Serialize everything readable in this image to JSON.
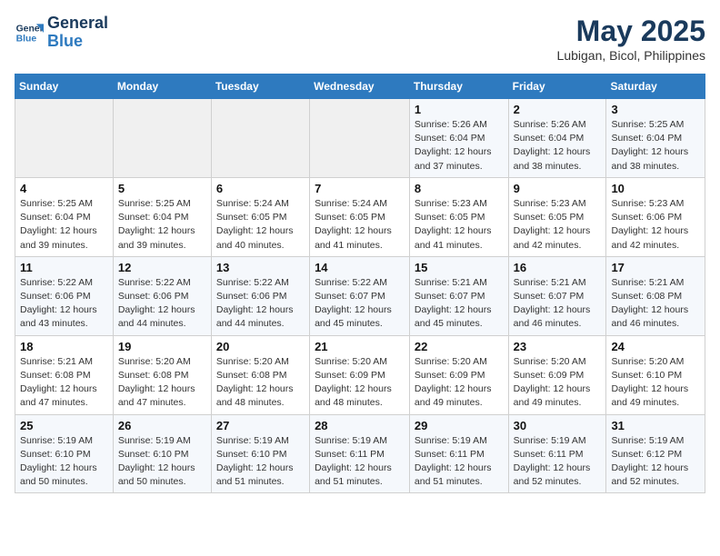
{
  "logo": {
    "line1": "General",
    "line2": "Blue"
  },
  "title": "May 2025",
  "subtitle": "Lubigan, Bicol, Philippines",
  "weekdays": [
    "Sunday",
    "Monday",
    "Tuesday",
    "Wednesday",
    "Thursday",
    "Friday",
    "Saturday"
  ],
  "weeks": [
    [
      {
        "day": "",
        "info": ""
      },
      {
        "day": "",
        "info": ""
      },
      {
        "day": "",
        "info": ""
      },
      {
        "day": "",
        "info": ""
      },
      {
        "day": "1",
        "info": "Sunrise: 5:26 AM\nSunset: 6:04 PM\nDaylight: 12 hours\nand 37 minutes."
      },
      {
        "day": "2",
        "info": "Sunrise: 5:26 AM\nSunset: 6:04 PM\nDaylight: 12 hours\nand 38 minutes."
      },
      {
        "day": "3",
        "info": "Sunrise: 5:25 AM\nSunset: 6:04 PM\nDaylight: 12 hours\nand 38 minutes."
      }
    ],
    [
      {
        "day": "4",
        "info": "Sunrise: 5:25 AM\nSunset: 6:04 PM\nDaylight: 12 hours\nand 39 minutes."
      },
      {
        "day": "5",
        "info": "Sunrise: 5:25 AM\nSunset: 6:04 PM\nDaylight: 12 hours\nand 39 minutes."
      },
      {
        "day": "6",
        "info": "Sunrise: 5:24 AM\nSunset: 6:05 PM\nDaylight: 12 hours\nand 40 minutes."
      },
      {
        "day": "7",
        "info": "Sunrise: 5:24 AM\nSunset: 6:05 PM\nDaylight: 12 hours\nand 41 minutes."
      },
      {
        "day": "8",
        "info": "Sunrise: 5:23 AM\nSunset: 6:05 PM\nDaylight: 12 hours\nand 41 minutes."
      },
      {
        "day": "9",
        "info": "Sunrise: 5:23 AM\nSunset: 6:05 PM\nDaylight: 12 hours\nand 42 minutes."
      },
      {
        "day": "10",
        "info": "Sunrise: 5:23 AM\nSunset: 6:06 PM\nDaylight: 12 hours\nand 42 minutes."
      }
    ],
    [
      {
        "day": "11",
        "info": "Sunrise: 5:22 AM\nSunset: 6:06 PM\nDaylight: 12 hours\nand 43 minutes."
      },
      {
        "day": "12",
        "info": "Sunrise: 5:22 AM\nSunset: 6:06 PM\nDaylight: 12 hours\nand 44 minutes."
      },
      {
        "day": "13",
        "info": "Sunrise: 5:22 AM\nSunset: 6:06 PM\nDaylight: 12 hours\nand 44 minutes."
      },
      {
        "day": "14",
        "info": "Sunrise: 5:22 AM\nSunset: 6:07 PM\nDaylight: 12 hours\nand 45 minutes."
      },
      {
        "day": "15",
        "info": "Sunrise: 5:21 AM\nSunset: 6:07 PM\nDaylight: 12 hours\nand 45 minutes."
      },
      {
        "day": "16",
        "info": "Sunrise: 5:21 AM\nSunset: 6:07 PM\nDaylight: 12 hours\nand 46 minutes."
      },
      {
        "day": "17",
        "info": "Sunrise: 5:21 AM\nSunset: 6:08 PM\nDaylight: 12 hours\nand 46 minutes."
      }
    ],
    [
      {
        "day": "18",
        "info": "Sunrise: 5:21 AM\nSunset: 6:08 PM\nDaylight: 12 hours\nand 47 minutes."
      },
      {
        "day": "19",
        "info": "Sunrise: 5:20 AM\nSunset: 6:08 PM\nDaylight: 12 hours\nand 47 minutes."
      },
      {
        "day": "20",
        "info": "Sunrise: 5:20 AM\nSunset: 6:08 PM\nDaylight: 12 hours\nand 48 minutes."
      },
      {
        "day": "21",
        "info": "Sunrise: 5:20 AM\nSunset: 6:09 PM\nDaylight: 12 hours\nand 48 minutes."
      },
      {
        "day": "22",
        "info": "Sunrise: 5:20 AM\nSunset: 6:09 PM\nDaylight: 12 hours\nand 49 minutes."
      },
      {
        "day": "23",
        "info": "Sunrise: 5:20 AM\nSunset: 6:09 PM\nDaylight: 12 hours\nand 49 minutes."
      },
      {
        "day": "24",
        "info": "Sunrise: 5:20 AM\nSunset: 6:10 PM\nDaylight: 12 hours\nand 49 minutes."
      }
    ],
    [
      {
        "day": "25",
        "info": "Sunrise: 5:19 AM\nSunset: 6:10 PM\nDaylight: 12 hours\nand 50 minutes."
      },
      {
        "day": "26",
        "info": "Sunrise: 5:19 AM\nSunset: 6:10 PM\nDaylight: 12 hours\nand 50 minutes."
      },
      {
        "day": "27",
        "info": "Sunrise: 5:19 AM\nSunset: 6:10 PM\nDaylight: 12 hours\nand 51 minutes."
      },
      {
        "day": "28",
        "info": "Sunrise: 5:19 AM\nSunset: 6:11 PM\nDaylight: 12 hours\nand 51 minutes."
      },
      {
        "day": "29",
        "info": "Sunrise: 5:19 AM\nSunset: 6:11 PM\nDaylight: 12 hours\nand 51 minutes."
      },
      {
        "day": "30",
        "info": "Sunrise: 5:19 AM\nSunset: 6:11 PM\nDaylight: 12 hours\nand 52 minutes."
      },
      {
        "day": "31",
        "info": "Sunrise: 5:19 AM\nSunset: 6:12 PM\nDaylight: 12 hours\nand 52 minutes."
      }
    ]
  ]
}
